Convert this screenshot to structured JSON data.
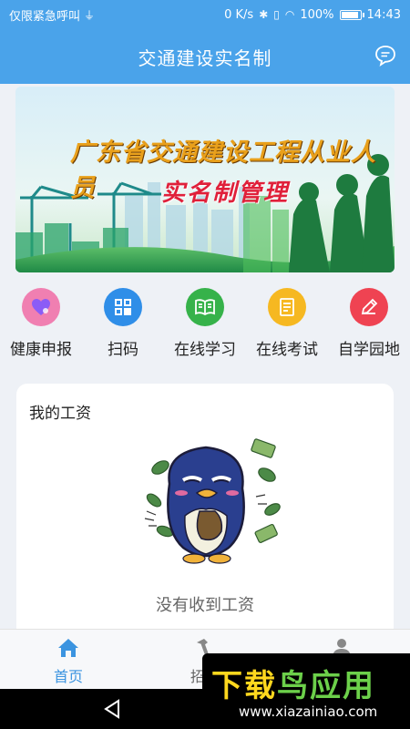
{
  "status_bar": {
    "carrier": "仅限紧急呼叫",
    "net_speed": "0 K/s",
    "battery": "100%",
    "time": "14:43"
  },
  "header": {
    "title": "交通建设实名制",
    "message_icon": "chat-bubble-icon"
  },
  "banner": {
    "line1": "广东省交通建设工程从业人员",
    "line2": "实名制管理"
  },
  "quick_actions": [
    {
      "label": "健康申报",
      "icon": "heart-icon",
      "color": "#f07fb1"
    },
    {
      "label": "扫码",
      "icon": "qr-scan-icon",
      "color": "#2f8ee8"
    },
    {
      "label": "在线学习",
      "icon": "book-icon",
      "color": "#36b24a"
    },
    {
      "label": "在线考试",
      "icon": "exam-paper-icon",
      "color": "#f6b821"
    },
    {
      "label": "自学园地",
      "icon": "pencil-icon",
      "color": "#ef4352"
    }
  ],
  "salary_card": {
    "title": "我的工资",
    "empty_text": "没有收到工资"
  },
  "tabs": [
    {
      "label": "首页",
      "icon": "home-icon",
      "active": true
    },
    {
      "label": "招聘",
      "icon": "hammer-icon",
      "active": false
    },
    {
      "label": "",
      "icon": "user-icon",
      "active": false
    }
  ],
  "watermark": {
    "brand_a": "下载",
    "brand_b": "鸟应用",
    "url": "www.xiazainiao.com"
  },
  "colors": {
    "accent": "#4aa3ea",
    "tab_active": "#3b94e0"
  }
}
